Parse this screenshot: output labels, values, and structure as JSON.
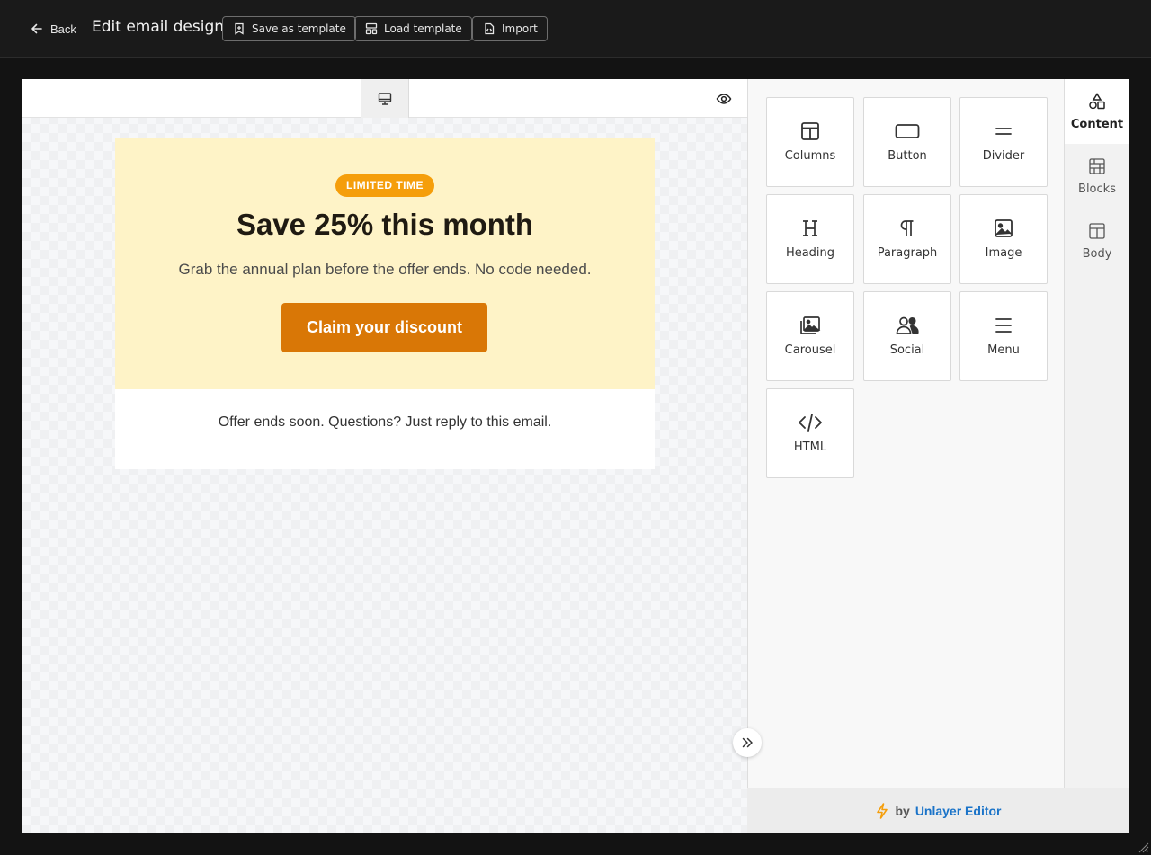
{
  "header": {
    "back_label": "Back",
    "title": "Edit email design",
    "buttons": [
      {
        "label": "Save as template",
        "icon": "bookmark-icon"
      },
      {
        "label": "Load template",
        "icon": "layout-template-icon"
      },
      {
        "label": "Import",
        "icon": "file-code-icon"
      }
    ]
  },
  "canvas": {
    "device_icon": "desktop-icon",
    "preview_icon": "eye-icon"
  },
  "email": {
    "badge": "LIMITED TIME",
    "headline": "Save 25% this month",
    "subtext": "Grab the annual plan before the offer ends. No code needed.",
    "cta": "Claim your discount",
    "footer": "Offer ends soon. Questions? Just reply to this email.",
    "colors": {
      "hero_bg": "#fef3c7",
      "badge": "#f59e0b",
      "cta": "#d97706"
    }
  },
  "tools": [
    {
      "label": "Columns",
      "icon": "columns-icon"
    },
    {
      "label": "Button",
      "icon": "button-icon"
    },
    {
      "label": "Divider",
      "icon": "divider-icon"
    },
    {
      "label": "Heading",
      "icon": "heading-icon"
    },
    {
      "label": "Paragraph",
      "icon": "paragraph-icon"
    },
    {
      "label": "Image",
      "icon": "image-icon"
    },
    {
      "label": "Carousel",
      "icon": "carousel-icon"
    },
    {
      "label": "Social",
      "icon": "social-icon"
    },
    {
      "label": "Menu",
      "icon": "menu-icon"
    },
    {
      "label": "HTML",
      "icon": "code-icon"
    }
  ],
  "tabs": [
    {
      "label": "Content",
      "icon": "shapes-icon",
      "active": true
    },
    {
      "label": "Blocks",
      "icon": "blocks-icon",
      "active": false
    },
    {
      "label": "Body",
      "icon": "body-layout-icon",
      "active": false
    }
  ],
  "branding": {
    "by": "by",
    "name": "Unlayer Editor",
    "accent": "#1a73c8"
  }
}
